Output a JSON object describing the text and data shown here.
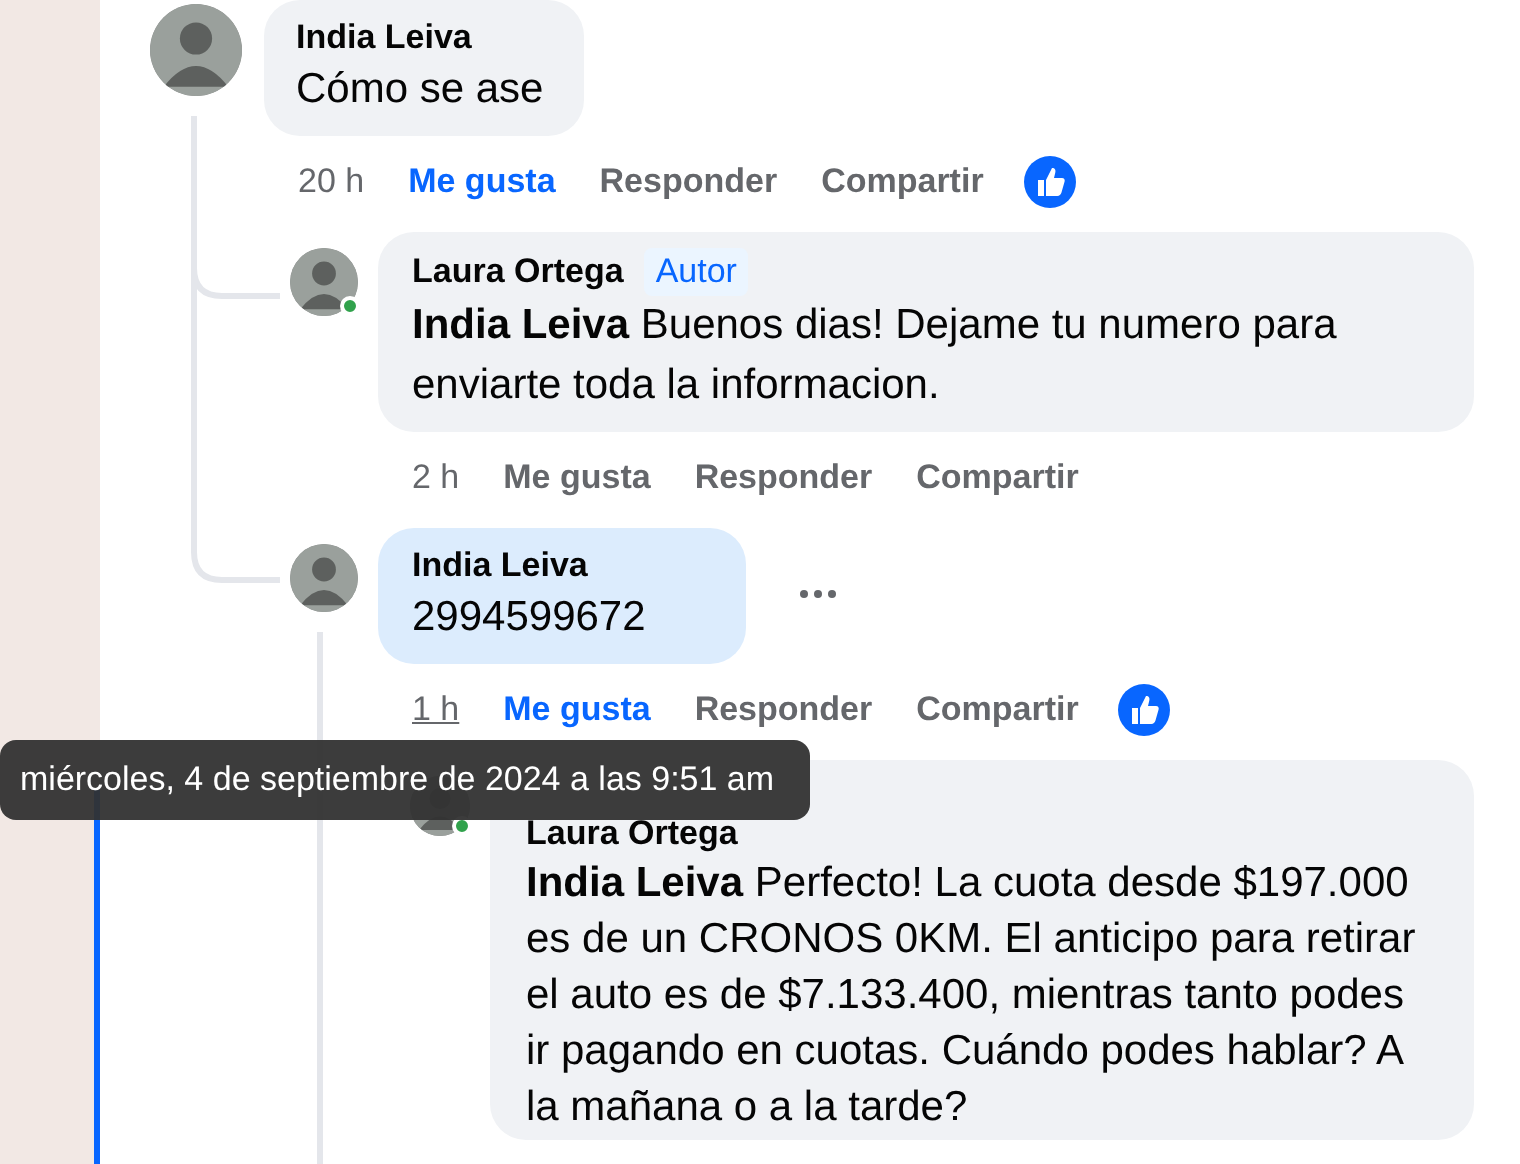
{
  "comments": [
    {
      "author": "India Leiva",
      "text": "Cómo se ase",
      "time": "20 h",
      "time_hovered": false,
      "like": "Me gusta",
      "liked": true,
      "reply": "Responder",
      "share": "Compartir",
      "reacted": true,
      "online": false,
      "highlighted": false,
      "children": [
        {
          "author": "Laura Ortega",
          "badge": "Autor",
          "mention": "India Leiva",
          "text": "Buenos dias! Dejame tu numero para enviarte toda la informacion.",
          "time": "2 h",
          "time_hovered": false,
          "like": "Me gusta",
          "liked": false,
          "reply": "Responder",
          "share": "Compartir",
          "reacted": false,
          "online": true,
          "highlighted": false
        },
        {
          "author": "India Leiva",
          "text": "2994599672",
          "time": "1 h",
          "time_hovered": true,
          "like": "Me gusta",
          "liked": true,
          "reply": "Responder",
          "share": "Compartir",
          "reacted": true,
          "online": false,
          "highlighted": true,
          "children": [
            {
              "author": "Laura Ortega",
              "mention": "India Leiva",
              "text": "Perfecto! La cuota desde $197.000 es de un CRONOS 0KM. El anticipo para retirar el auto es de $7.133.400, mientras tanto podes ir pagando en cuotas. Cuándo podes hablar? A la mañana o a la tarde?",
              "online": true,
              "highlighted": false
            }
          ]
        }
      ]
    }
  ],
  "tooltip": {
    "text": "miércoles, 4 de septiembre de 2024 a las 9:51 am"
  }
}
